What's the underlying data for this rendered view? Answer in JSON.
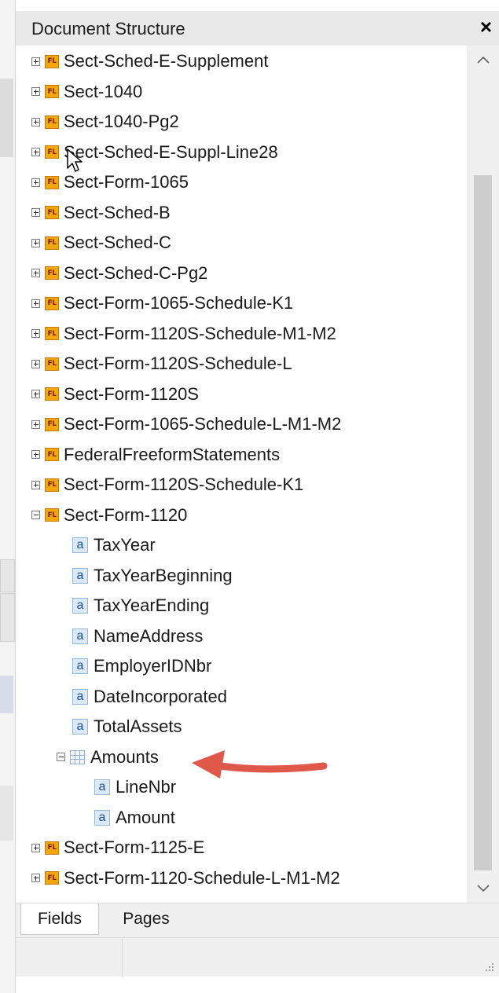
{
  "panel": {
    "title": "Document Structure",
    "close_label": "×"
  },
  "tree": [
    {
      "label": "Sect-Sched-E-Supplement",
      "type": "section",
      "expanded": false
    },
    {
      "label": "Sect-1040",
      "type": "section",
      "expanded": false
    },
    {
      "label": "Sect-1040-Pg2",
      "type": "section",
      "expanded": false
    },
    {
      "label": "Sect-Sched-E-Suppl-Line28",
      "type": "section",
      "expanded": false
    },
    {
      "label": "Sect-Form-1065",
      "type": "section",
      "expanded": false
    },
    {
      "label": "Sect-Sched-B",
      "type": "section",
      "expanded": false
    },
    {
      "label": "Sect-Sched-C",
      "type": "section",
      "expanded": false
    },
    {
      "label": "Sect-Sched-C-Pg2",
      "type": "section",
      "expanded": false
    },
    {
      "label": "Sect-Form-1065-Schedule-K1",
      "type": "section",
      "expanded": false
    },
    {
      "label": "Sect-Form-1120S-Schedule-M1-M2",
      "type": "section",
      "expanded": false
    },
    {
      "label": "Sect-Form-1120S-Schedule-L",
      "type": "section",
      "expanded": false
    },
    {
      "label": "Sect-Form-1120S",
      "type": "section",
      "expanded": false
    },
    {
      "label": "Sect-Form-1065-Schedule-L-M1-M2",
      "type": "section",
      "expanded": false
    },
    {
      "label": "FederalFreeformStatements",
      "type": "section",
      "expanded": false
    },
    {
      "label": "Sect-Form-1120S-Schedule-K1",
      "type": "section",
      "expanded": false
    },
    {
      "label": "Sect-Form-1120",
      "type": "section",
      "expanded": true
    },
    {
      "label": "TaxYear",
      "type": "field"
    },
    {
      "label": "TaxYearBeginning",
      "type": "field"
    },
    {
      "label": "TaxYearEnding",
      "type": "field"
    },
    {
      "label": "NameAddress",
      "type": "field"
    },
    {
      "label": "EmployerIDNbr",
      "type": "field"
    },
    {
      "label": "DateIncorporated",
      "type": "field"
    },
    {
      "label": "TotalAssets",
      "type": "field"
    },
    {
      "label": "Amounts",
      "type": "table",
      "expanded": true
    },
    {
      "label": "LineNbr",
      "type": "field"
    },
    {
      "label": "Amount",
      "type": "field"
    },
    {
      "label": "Sect-Form-1125-E",
      "type": "section",
      "expanded": false
    },
    {
      "label": "Sect-Form-1120-Schedule-L-M1-M2",
      "type": "section",
      "expanded": false
    }
  ],
  "section_icon_text": "FL",
  "field_icon_text": "a",
  "tabs": [
    {
      "label": "Fields",
      "active": true
    },
    {
      "label": "Pages",
      "active": false
    }
  ],
  "colors": {
    "section_icon": "#f3a70d",
    "annotation_arrow": "#e0584a"
  }
}
